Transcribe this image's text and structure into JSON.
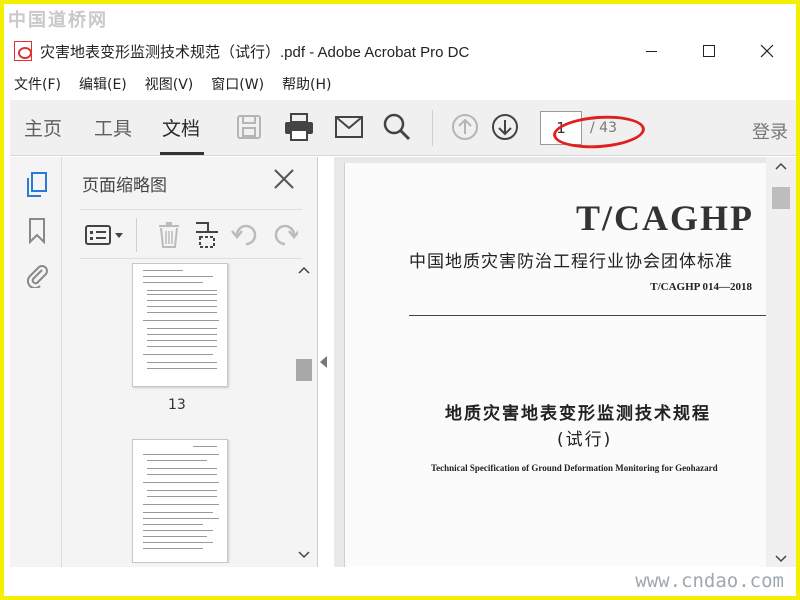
{
  "watermark": {
    "top": "中国道桥网",
    "bottom": "www.cndao.com"
  },
  "window": {
    "title": "灾害地表变形监测技术规范（试行）.pdf - Adobe Acrobat Pro DC",
    "minimize": "—",
    "maximize": "☐",
    "close": "✕"
  },
  "menubar": {
    "items": [
      {
        "label": "文件(F)"
      },
      {
        "label": "编辑(E)"
      },
      {
        "label": "视图(V)"
      },
      {
        "label": "窗口(W)"
      },
      {
        "label": "帮助(H)"
      }
    ]
  },
  "toolbar": {
    "tabs": [
      {
        "label": "主页"
      },
      {
        "label": "工具"
      },
      {
        "label": "文档"
      }
    ],
    "page_current": "1",
    "page_total": "/ 43",
    "signin": "登录",
    "icons": [
      "save-icon",
      "print-icon",
      "email-icon",
      "search-icon",
      "page-up-icon",
      "page-down-icon"
    ],
    "annotation_color": "#e0201e"
  },
  "thumbnails": {
    "title": "页面缩略图",
    "pages": [
      {
        "number": "13"
      },
      {
        "number": ""
      }
    ]
  },
  "document": {
    "code": "T/CAGHP",
    "association": "中国地质灾害防治工程行业协会团体标准",
    "standard_number": "T/CAGHP 014—2018",
    "title": "地质灾害地表变形监测技术规程",
    "subtitle": "(试行)",
    "title_en": "Technical Specification of Ground Deformation Monitoring for Geohazard"
  }
}
